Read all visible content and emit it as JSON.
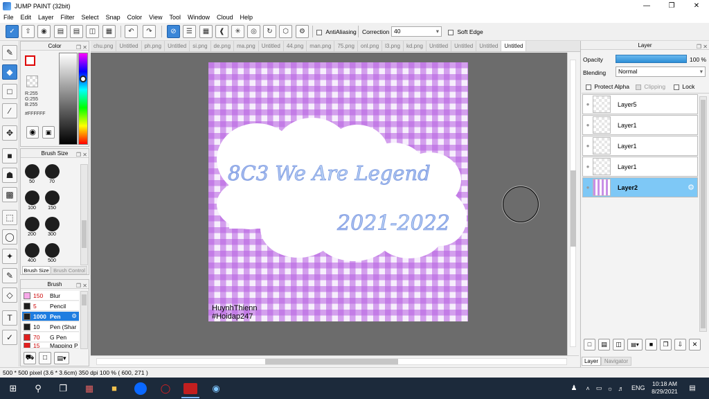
{
  "window": {
    "title": "JUMP PAINT (32bit)"
  },
  "menu": [
    "File",
    "Edit",
    "Layer",
    "Filter",
    "Select",
    "Snap",
    "Color",
    "View",
    "Tool",
    "Window",
    "Cloud",
    "Help"
  ],
  "toolbar": {
    "antialiasing_label": "AntiAliasing",
    "correction_label": "Correction",
    "correction_value": "40",
    "soft_edge_label": "Soft Edge"
  },
  "color_panel": {
    "title": "Color",
    "r": "R:255",
    "g": "G:255",
    "b": "B:255",
    "hex": "#FFFFFF"
  },
  "brush_size_panel": {
    "title": "Brush Size",
    "sizes": [
      "50",
      "70",
      "100",
      "150",
      "200",
      "300",
      "400",
      "500"
    ],
    "tabs": [
      "Brush Size",
      "Brush Control"
    ]
  },
  "brush_panel": {
    "title": "Brush",
    "items": [
      {
        "size": "150",
        "name": "Blur",
        "color": "#f7a8e8"
      },
      {
        "size": "5",
        "name": "Pencil",
        "color": "#1e1e1e"
      },
      {
        "size": "1000",
        "name": "Pen",
        "color": "#1e1e1e",
        "selected": true
      },
      {
        "size": "10",
        "name": "Pen (Shar",
        "color": "#1e1e1e"
      },
      {
        "size": "70",
        "name": "G Pen",
        "color": "#e02020"
      },
      {
        "size": "15",
        "name": "Mapping P",
        "color": "#e02020"
      }
    ]
  },
  "doc_tabs": [
    "chu.png",
    "Untitled",
    "ph.png",
    "Untitled",
    "si.png",
    "de.png",
    "ma.png",
    "Untitled",
    "44.png",
    "man.png",
    "75.png",
    "onl.png",
    "l3.png",
    "kd.png",
    "Untitled",
    "Untitled",
    "Untitled",
    "Untitled"
  ],
  "artwork": {
    "line1": "8C3 We Are Legend",
    "line2": "2021-2022",
    "credit1": "HuynhThienn",
    "credit2": "#Hoidap247",
    "gingham_color": "#b65ee0"
  },
  "layer_panel": {
    "title": "Layer",
    "opacity_label": "Opacity",
    "opacity_value": "100 %",
    "blending_label": "Blending",
    "blending_value": "Normal",
    "protect_alpha": "Protect Alpha",
    "clipping": "Clipping",
    "lock": "Lock",
    "layers": [
      "Layer5",
      "Layer1",
      "Layer1",
      "Layer1",
      "Layer2"
    ],
    "tabs": [
      "Layer",
      "Navigator"
    ]
  },
  "status": {
    "text": "500 * 500 pixel   (3.6 * 3.6cm)   350 dpi   100 %   ( 600, 271 )"
  },
  "taskbar": {
    "lang": "ENG",
    "time": "10:18 AM",
    "date": "8/29/2021"
  }
}
